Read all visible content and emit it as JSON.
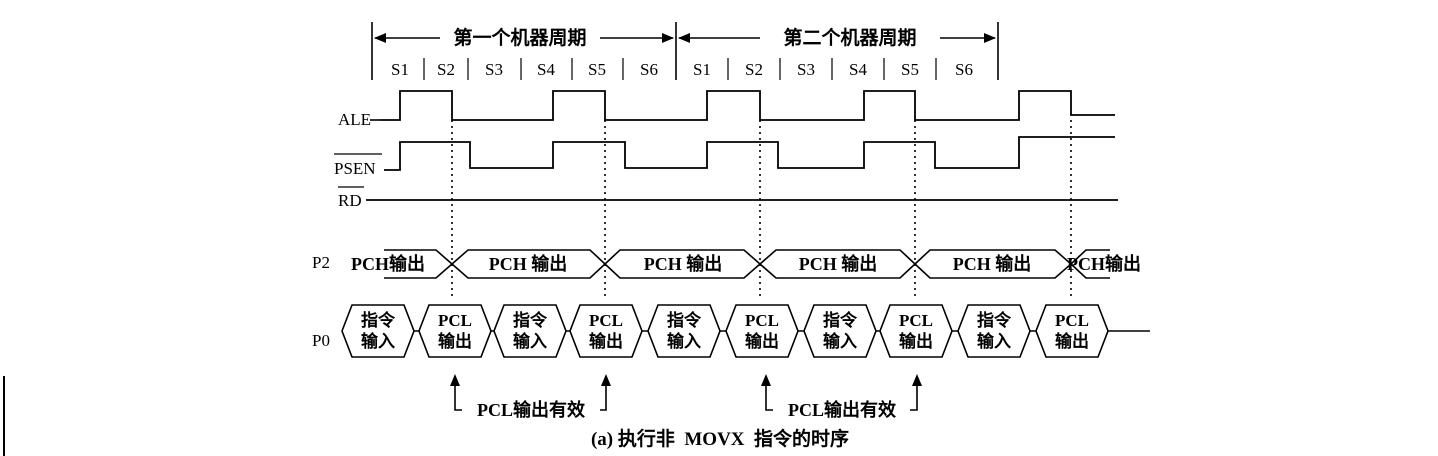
{
  "colors": {
    "ink": "#000000",
    "background": "#ffffff"
  },
  "period_labels": [
    "第一个机器周期",
    "第二个机器周期"
  ],
  "states": [
    "S1",
    "S2",
    "S3",
    "S4",
    "S5",
    "S6",
    "S1",
    "S2",
    "S3",
    "S4",
    "S5",
    "S6"
  ],
  "signals": {
    "ale": "ALE",
    "psen": "PSEN",
    "rd": "RD",
    "p2": "P2",
    "p0": "P0"
  },
  "p2_bus": {
    "first_label": "PCH输出",
    "segments": [
      "PCH 输出",
      "PCH 输出",
      "PCH 输出",
      "PCH 输出",
      "PCH 输出"
    ],
    "last_label": "PCH输出"
  },
  "p0_bus": {
    "hexes": [
      [
        "指令",
        "输入"
      ],
      [
        "PCL",
        "输出"
      ],
      [
        "指令",
        "输入"
      ],
      [
        "PCL",
        "输出"
      ],
      [
        "指令",
        "输入"
      ],
      [
        "PCL",
        "输出"
      ],
      [
        "指令",
        "输入"
      ],
      [
        "PCL",
        "输出"
      ],
      [
        "指令",
        "输入"
      ],
      [
        "PCL",
        "输出"
      ]
    ]
  },
  "annotations": [
    "PCL输出有效",
    "PCL输出有效"
  ],
  "caption": "(a) 执行非  MOVX  指令的时序"
}
